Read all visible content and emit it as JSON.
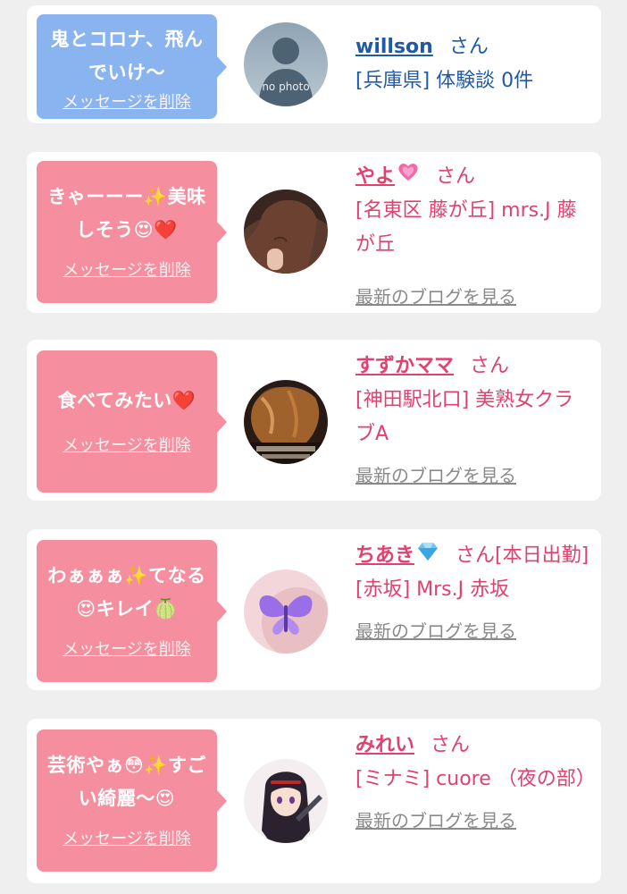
{
  "colors": {
    "background": "#efefef",
    "card": "#ffffff",
    "bubble_blue": "#8ab4f0",
    "bubble_pink": "#f58fa0",
    "name_pink": "#e0416f",
    "name_blue": "#1f5aa8",
    "link_gray": "#8a8a8a"
  },
  "cards": [
    {
      "bubble_color": "blue",
      "message": "鬼とコロナ、飛んでいけ〜",
      "delete_label": "メッセージを削除",
      "name": "willson",
      "san": "さん",
      "shop": "[兵庫県] 体験談 0件",
      "avatar_icon": "no-photo-silhouette",
      "avatar_caption": "no photo"
    },
    {
      "bubble_color": "pink",
      "message": "きゃーーー✨美味しそう😍❤️",
      "delete_label": "メッセージを削除",
      "name": "やよ",
      "name_icon": "sparkling-heart-icon",
      "san": "さん",
      "shop": "[名東区 藤が丘] mrs.J 藤が丘",
      "blog_link": "最新のブログを見る",
      "avatar_icon": "woman-photo"
    },
    {
      "bubble_color": "pink",
      "message": "食べてみたい❤️",
      "delete_label": "メッセージを削除",
      "name": "すずかママ",
      "san": "さん",
      "shop": "[神田駅北口] 美熟女クラブA",
      "blog_link": "最新のブログを見る",
      "avatar_icon": "woman-photo"
    },
    {
      "bubble_color": "pink",
      "message": "わぁぁぁ✨てなる😍キレイ🍈",
      "delete_label": "メッセージを削除",
      "name": "ちあき",
      "name_icon": "gem-icon",
      "san": "さん[本日出勤]",
      "shop": "[赤坂] Mrs.J 赤坂",
      "blog_link": "最新のブログを見る",
      "avatar_icon": "butterfly-photo"
    },
    {
      "bubble_color": "pink",
      "message": "芸術やぁ😳✨すごい綺麗〜😍",
      "delete_label": "メッセージを削除",
      "name": "みれい",
      "san": "さん",
      "shop": "[ミナミ] cuore （夜の部）",
      "blog_link": "最新のブログを見る",
      "avatar_icon": "anime-character-photo"
    }
  ]
}
